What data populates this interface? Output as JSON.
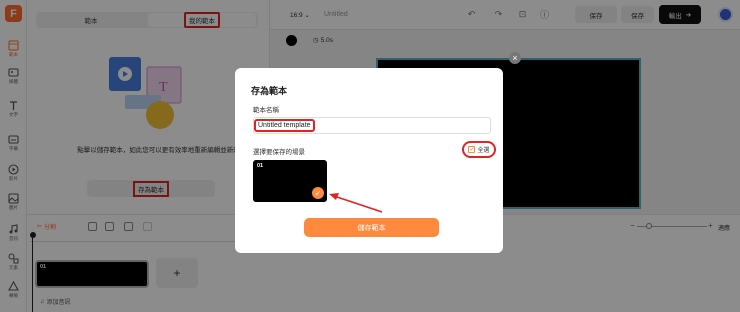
{
  "logo_letter": "F",
  "rail": [
    {
      "icon": "layout-icon",
      "label": "範本",
      "active": true
    },
    {
      "icon": "image-icon",
      "label": "媒體",
      "active": false
    },
    {
      "icon": "text-icon",
      "label": "文字",
      "active": false
    },
    {
      "icon": "caption-icon",
      "label": "字幕",
      "active": false
    },
    {
      "icon": "video-icon",
      "label": "影片",
      "active": false
    },
    {
      "icon": "photo-icon",
      "label": "圖片",
      "active": false
    },
    {
      "icon": "music-icon",
      "label": "音訊",
      "active": false
    },
    {
      "icon": "elements-icon",
      "label": "元素",
      "active": false
    },
    {
      "icon": "transition-icon",
      "label": "轉場",
      "active": false
    }
  ],
  "panel": {
    "tab_templates": "範本",
    "tab_my_templates": "我的範本",
    "description": "點擊以儲存範本，如此您可以更有效率地重新編輯並新的影片",
    "save_as_template": "存為範本"
  },
  "topbar": {
    "ratio": "16:9",
    "project_title": "Untitled",
    "save_label_1": "保存",
    "save_label_2": "保存",
    "export_label": "輸出"
  },
  "secondary": {
    "duration": "5.0s"
  },
  "timeline": {
    "split_label": "分割",
    "clip_label": "01",
    "add_audio": "添加音訊",
    "fit_label": "適應"
  },
  "modal": {
    "title": "存為範本",
    "name_label": "範本名稱",
    "name_value": "Untitled template",
    "scene_label": "選擇要保存的場景",
    "select_all": "全選",
    "scene_label_01": "01",
    "save_button": "儲存範本"
  },
  "colors": {
    "accent": "#ff8a3d",
    "highlight_box": "#e02424",
    "canvas_border": "#4db6c7"
  }
}
